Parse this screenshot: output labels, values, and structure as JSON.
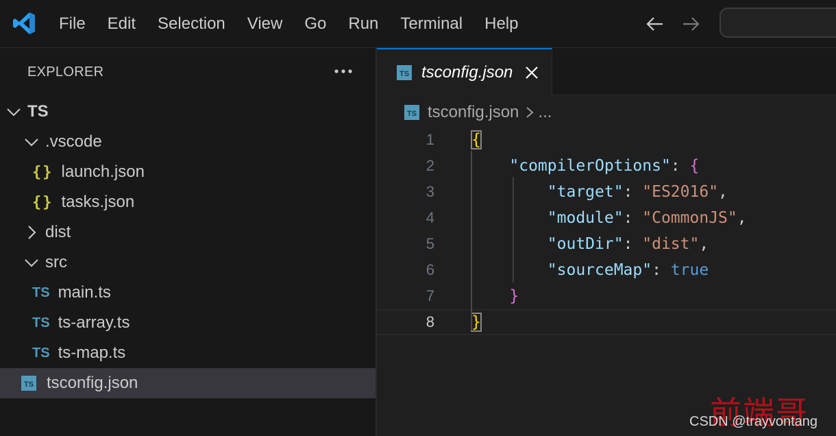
{
  "titlebar": {
    "menu": [
      "File",
      "Edit",
      "Selection",
      "View",
      "Go",
      "Run",
      "Terminal",
      "Help"
    ],
    "icons": {
      "logo": "vscode-logo-icon",
      "back": "arrow-left-icon",
      "forward": "arrow-right-icon"
    },
    "accent": "#0078d4"
  },
  "sidebar": {
    "title": "EXPLORER",
    "more_actions": "ellipsis-icon",
    "tree": [
      {
        "label": "TS",
        "type": "root-folder",
        "expanded": true,
        "depth": 0
      },
      {
        "label": ".vscode",
        "type": "folder",
        "expanded": true,
        "depth": 1
      },
      {
        "label": "launch.json",
        "type": "json-file",
        "icon_text": "{}",
        "depth": 2
      },
      {
        "label": "tasks.json",
        "type": "json-file",
        "icon_text": "{}",
        "depth": 2
      },
      {
        "label": "dist",
        "type": "folder",
        "expanded": false,
        "depth": 1
      },
      {
        "label": "src",
        "type": "folder",
        "expanded": true,
        "depth": 1
      },
      {
        "label": "main.ts",
        "type": "ts-file",
        "icon_text": "TS",
        "depth": 2
      },
      {
        "label": "ts-array.ts",
        "type": "ts-file",
        "icon_text": "TS",
        "depth": 2
      },
      {
        "label": "ts-map.ts",
        "type": "ts-file",
        "icon_text": "TS",
        "depth": 2
      },
      {
        "label": "tsconfig.json",
        "type": "tsconfig-file",
        "icon_text": "TS",
        "depth": 1,
        "selected": true
      }
    ]
  },
  "editor": {
    "tab": {
      "label": "tsconfig.json",
      "icon_text": "TS",
      "active": true
    },
    "breadcrumb": {
      "file": "tsconfig.json",
      "rest": "..."
    },
    "current_line": 8,
    "lines": [
      {
        "n": "1",
        "tokens": [
          [
            "y",
            "{"
          ]
        ]
      },
      {
        "n": "2",
        "tokens": [
          [
            "p",
            "    "
          ],
          [
            "k",
            "\"compilerOptions\""
          ],
          [
            "p",
            ": "
          ],
          [
            "m",
            "{"
          ]
        ]
      },
      {
        "n": "3",
        "tokens": [
          [
            "p",
            "        "
          ],
          [
            "k",
            "\"target\""
          ],
          [
            "p",
            ": "
          ],
          [
            "s",
            "\"ES2016\""
          ],
          [
            "p",
            ","
          ]
        ]
      },
      {
        "n": "4",
        "tokens": [
          [
            "p",
            "        "
          ],
          [
            "k",
            "\"module\""
          ],
          [
            "p",
            ": "
          ],
          [
            "s",
            "\"CommonJS\""
          ],
          [
            "p",
            ","
          ]
        ]
      },
      {
        "n": "5",
        "tokens": [
          [
            "p",
            "        "
          ],
          [
            "k",
            "\"outDir\""
          ],
          [
            "p",
            ": "
          ],
          [
            "s",
            "\"dist\""
          ],
          [
            "p",
            ","
          ]
        ]
      },
      {
        "n": "6",
        "tokens": [
          [
            "p",
            "        "
          ],
          [
            "k",
            "\"sourceMap\""
          ],
          [
            "p",
            ": "
          ],
          [
            "b",
            "true"
          ]
        ]
      },
      {
        "n": "7",
        "tokens": [
          [
            "p",
            "    "
          ],
          [
            "m",
            "}"
          ]
        ]
      },
      {
        "n": "8",
        "tokens": [
          [
            "y",
            "}"
          ]
        ]
      }
    ]
  },
  "watermark": {
    "cn": "前端哥",
    "text": "CSDN @trayvontang"
  }
}
